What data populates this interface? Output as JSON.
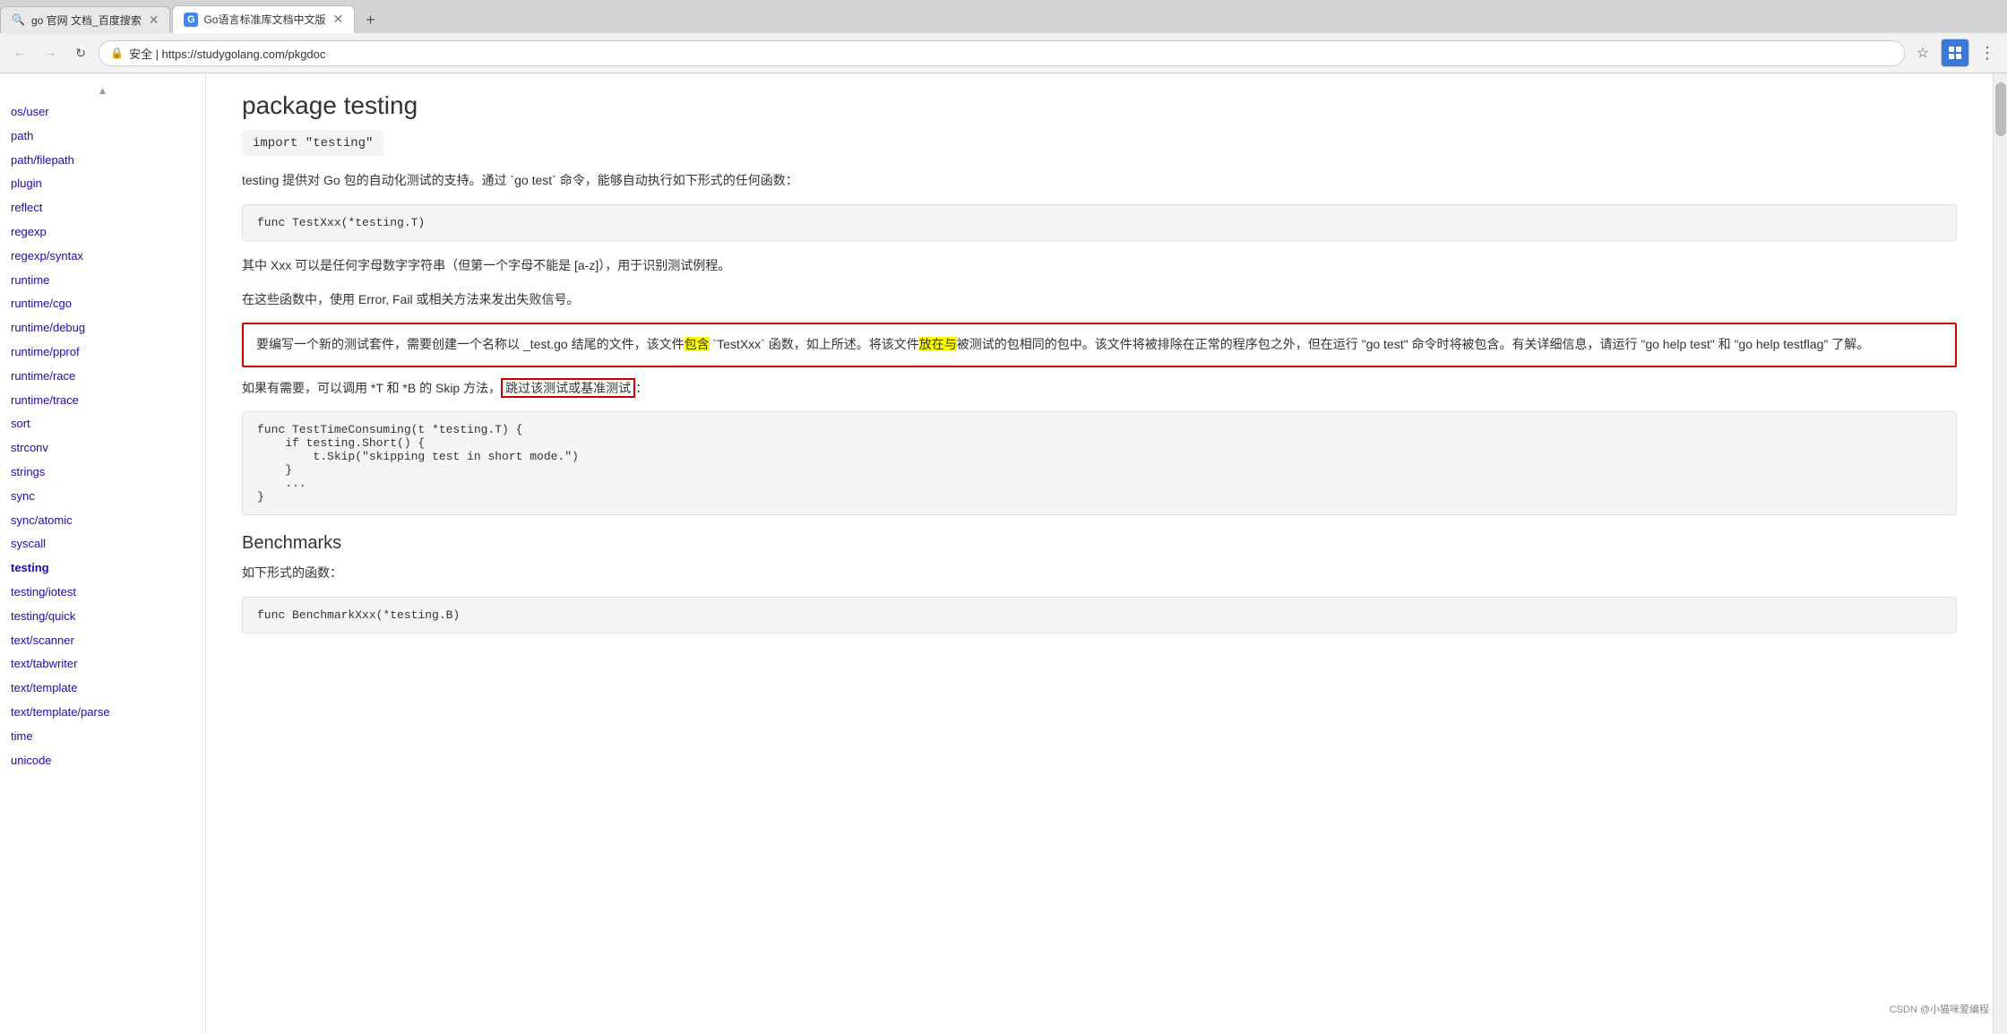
{
  "browser": {
    "tabs": [
      {
        "id": "tab1",
        "title": "go 官网 文档_百度搜索",
        "active": false,
        "favicon": "🔍"
      },
      {
        "id": "tab2",
        "title": "Go语言标准库文档中文版",
        "active": true,
        "favicon": "G"
      }
    ],
    "url": "https://studygolang.com/pkgdoc",
    "url_display": "安全 | https://studygolang.com/pkgdoc",
    "lock_label": "🔒",
    "back_btn": "←",
    "forward_btn": "→",
    "reload_btn": "↺",
    "star_btn": "☆",
    "menu_btn": "⋮"
  },
  "sidebar": {
    "items": [
      {
        "label": "os/user",
        "href": "#",
        "active": false
      },
      {
        "label": "path",
        "href": "#",
        "active": false
      },
      {
        "label": "path/filepath",
        "href": "#",
        "active": false
      },
      {
        "label": "plugin",
        "href": "#",
        "active": false
      },
      {
        "label": "reflect",
        "href": "#",
        "active": false
      },
      {
        "label": "regexp",
        "href": "#",
        "active": false
      },
      {
        "label": "regexp/syntax",
        "href": "#",
        "active": false
      },
      {
        "label": "runtime",
        "href": "#",
        "active": false
      },
      {
        "label": "runtime/cgo",
        "href": "#",
        "active": false
      },
      {
        "label": "runtime/debug",
        "href": "#",
        "active": false
      },
      {
        "label": "runtime/pprof",
        "href": "#",
        "active": false
      },
      {
        "label": "runtime/race",
        "href": "#",
        "active": false
      },
      {
        "label": "runtime/trace",
        "href": "#",
        "active": false
      },
      {
        "label": "sort",
        "href": "#",
        "active": false
      },
      {
        "label": "strconv",
        "href": "#",
        "active": false
      },
      {
        "label": "strings",
        "href": "#",
        "active": false
      },
      {
        "label": "sync",
        "href": "#",
        "active": false
      },
      {
        "label": "sync/atomic",
        "href": "#",
        "active": false
      },
      {
        "label": "syscall",
        "href": "#",
        "active": false
      },
      {
        "label": "testing",
        "href": "#",
        "active": true
      },
      {
        "label": "testing/iotest",
        "href": "#",
        "active": false
      },
      {
        "label": "testing/quick",
        "href": "#",
        "active": false
      },
      {
        "label": "text/scanner",
        "href": "#",
        "active": false
      },
      {
        "label": "text/tabwriter",
        "href": "#",
        "active": false
      },
      {
        "label": "text/template",
        "href": "#",
        "active": false
      },
      {
        "label": "text/template/parse",
        "href": "#",
        "active": false
      },
      {
        "label": "time",
        "href": "#",
        "active": false
      },
      {
        "label": "unicode",
        "href": "#",
        "active": false
      }
    ]
  },
  "main": {
    "package_title": "package testing",
    "import_line": "import \"testing\"",
    "description1": "testing 提供对 Go 包的自动化测试的支持。通过 `go test` 命令，能够自动执行如下形式的任何函数：",
    "code1": "func TestXxx(*testing.T)",
    "description2": "其中 Xxx 可以是任何字母数字字符串（但第一个字母不能是 [a-z]），用于识别测试例程。",
    "description3": "在这些函数中，使用 Error, Fail 或相关方法来发出失败信号。",
    "highlighted_para": "要编写一个新的测试套件，需要创建一个名称以 _test.go 结尾的文件，该文件包含 `TestXxx` 函数，如上所述。将该文件放在与被测试的包相同的包中。该文件将被排除在正常的程序包之外，但在运行 \"go test\" 命令时将被包含。有关详细信息，请运行 \"go help test\" 和 \"go help testflag\" 了解。",
    "description4": "如果有需要，可以调用 *T 和 *B 的 Skip 方法，",
    "skip_link_text": "跳过该测试或基准测试",
    "description4_end": "：",
    "code2_lines": [
      "func TestTimeConsuming(t *testing.T) {",
      "    if testing.Short() {",
      "        t.Skip(\"skipping test in short mode.\")",
      "    }",
      "    ...",
      "}"
    ],
    "benchmarks_title": "Benchmarks",
    "benchmarks_desc": "如下形式的函数：",
    "code3": "func BenchmarkXxx(*testing.B)"
  },
  "watermark": {
    "text": "CSDN @小猫咪爱编程"
  }
}
